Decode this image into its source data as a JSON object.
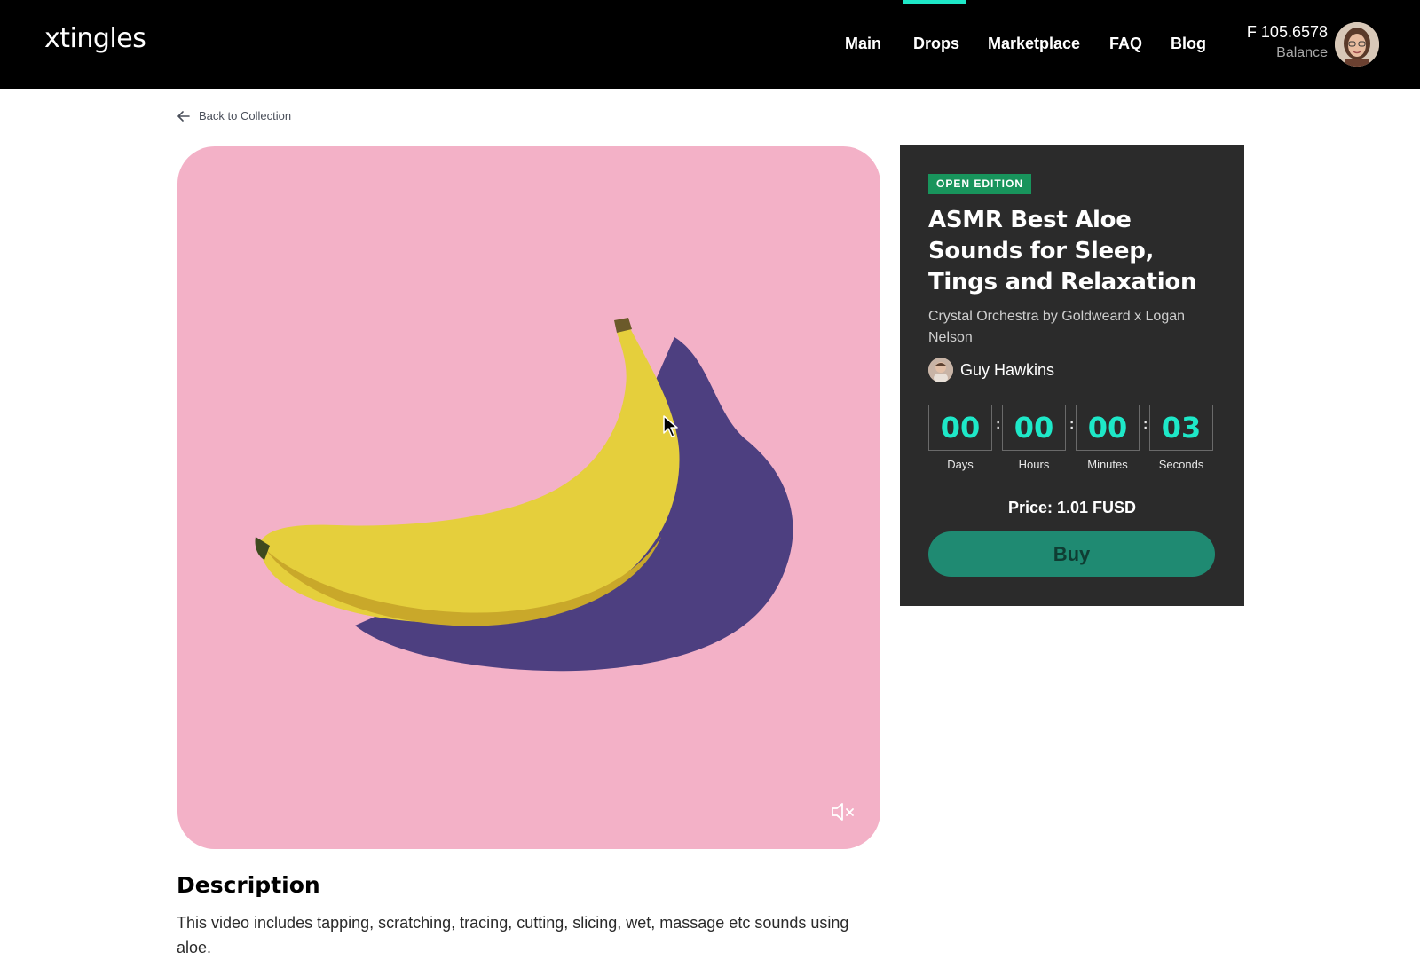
{
  "header": {
    "logo": "xtingles",
    "nav": [
      "Main",
      "Drops",
      "Marketplace",
      "FAQ",
      "Blog"
    ],
    "active_nav": "Drops",
    "balance_amount": "F 105.6578",
    "balance_label": "Balance"
  },
  "back_link": "Back to Collection",
  "item": {
    "badge": "OPEN EDITION",
    "title": "ASMR Best Aloe Sounds for Sleep, Tings and Relaxation",
    "collection": "Crystal Orchestra by Goldweard x Logan Nelson",
    "creator": "Guy Hawkins",
    "timer": {
      "days": "00",
      "hours": "00",
      "minutes": "00",
      "seconds": "03",
      "labels": [
        "Days",
        "Hours",
        "Minutes",
        "Seconds"
      ],
      "separator": ":"
    },
    "price": "Price: 1.01 FUSD",
    "buy_label": "Buy"
  },
  "description": {
    "title": "Description",
    "text": "This video includes tapping, scratching, tracing, cutting, slicing, wet, massage etc sounds using aloe."
  },
  "colors": {
    "accent": "#1ee8c8",
    "badge": "#18945c",
    "buy_button": "#1f8a72",
    "media_background": "#f3b1c7",
    "panel": "#2b2b2b"
  }
}
